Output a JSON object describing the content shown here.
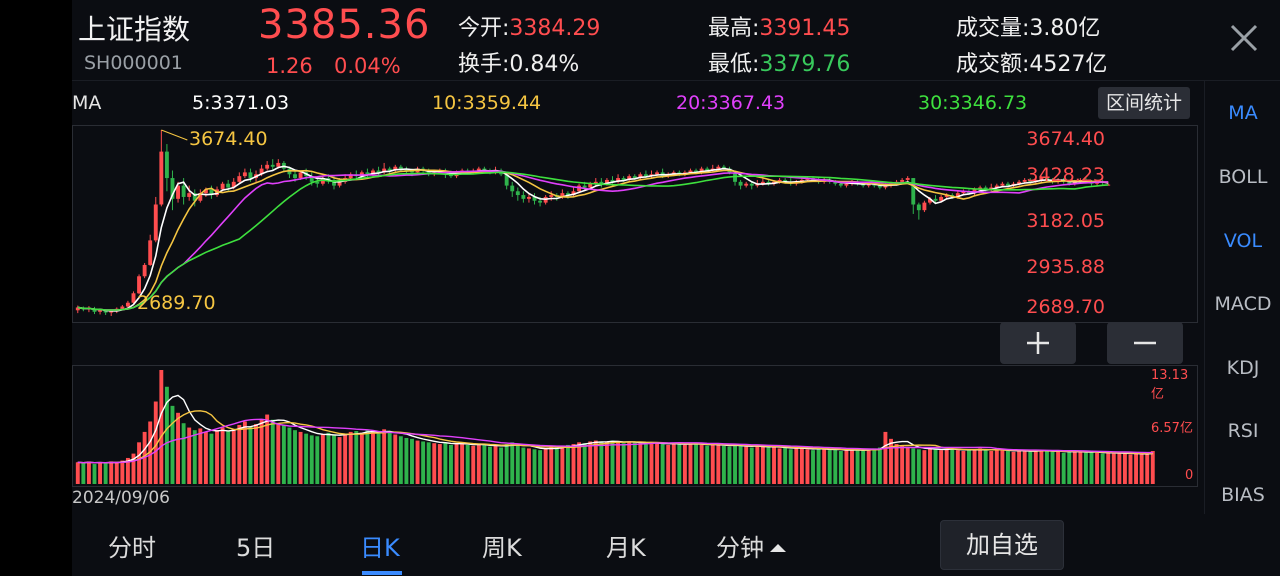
{
  "stock": {
    "name": "上证指数",
    "code": "SH000001",
    "price": "3385.36",
    "change": "1.26",
    "change_pct": "0.04%"
  },
  "stats": [
    {
      "label": "今开:",
      "value": "3384.29",
      "color": "r"
    },
    {
      "label": "最高:",
      "value": "3391.45",
      "color": "r"
    },
    {
      "label": "成交量:",
      "value": "3.80亿",
      "color": ""
    },
    {
      "label": "换手:",
      "value": "0.84%",
      "color": ""
    },
    {
      "label": "最低:",
      "value": "3379.76",
      "color": "g"
    },
    {
      "label": "成交额:",
      "value": "4527亿",
      "color": ""
    }
  ],
  "ma": {
    "label": "MA",
    "ma5": "5:3371.03",
    "ma10": "10:3359.44",
    "ma20": "20:3367.43",
    "ma30": "30:3346.73",
    "colors": {
      "ma5": "#ffffff",
      "ma10": "#f5c542",
      "ma20": "#e040fb",
      "ma30": "#3ee03e"
    }
  },
  "range_button": "区间统计",
  "price_axis": [
    "3674.40",
    "3428.23",
    "3182.05",
    "2935.88",
    "2689.70"
  ],
  "annot_high": "3674.40",
  "annot_low": "2689.70",
  "vol_axis": [
    "13.13亿",
    "6.57亿",
    "0"
  ],
  "date": "2024/09/06",
  "sidebar": [
    "MA",
    "BOLL",
    "VOL",
    "MACD",
    "KDJ",
    "RSI",
    "BIAS"
  ],
  "tabs": [
    "分时",
    "5日",
    "日K",
    "周K",
    "月K",
    "分钟"
  ],
  "add_button": "加自选",
  "colors": {
    "up": "#ff4d4f",
    "down": "#2fb34c",
    "accent": "#3a8bff"
  },
  "chart_data": {
    "type": "candlestick",
    "ylim": [
      2689.7,
      3674.4
    ],
    "candles": [
      [
        2720,
        2735,
        2705,
        2745
      ],
      [
        2735,
        2725,
        2715,
        2740
      ],
      [
        2725,
        2730,
        2710,
        2742
      ],
      [
        2730,
        2712,
        2700,
        2738
      ],
      [
        2712,
        2720,
        2698,
        2730
      ],
      [
        2720,
        2708,
        2695,
        2725
      ],
      [
        2708,
        2715,
        2690,
        2722
      ],
      [
        2715,
        2728,
        2705,
        2735
      ],
      [
        2728,
        2740,
        2720,
        2748
      ],
      [
        2740,
        2760,
        2735,
        2770
      ],
      [
        2760,
        2810,
        2755,
        2820
      ],
      [
        2810,
        2900,
        2805,
        2910
      ],
      [
        2900,
        2960,
        2890,
        2970
      ],
      [
        2960,
        3090,
        2955,
        3120
      ],
      [
        3090,
        3280,
        3080,
        3320
      ],
      [
        3280,
        3560,
        3270,
        3674.4
      ],
      [
        3560,
        3420,
        3350,
        3600
      ],
      [
        3420,
        3310,
        3250,
        3460
      ],
      [
        3310,
        3380,
        3290,
        3400
      ],
      [
        3380,
        3320,
        3280,
        3420
      ],
      [
        3320,
        3340,
        3300,
        3380
      ],
      [
        3340,
        3300,
        3270,
        3360
      ],
      [
        3300,
        3340,
        3290,
        3360
      ],
      [
        3340,
        3360,
        3320,
        3370
      ],
      [
        3360,
        3330,
        3310,
        3380
      ],
      [
        3330,
        3360,
        3320,
        3375
      ],
      [
        3360,
        3390,
        3350,
        3400
      ],
      [
        3390,
        3370,
        3350,
        3410
      ],
      [
        3370,
        3400,
        3360,
        3420
      ],
      [
        3400,
        3430,
        3390,
        3450
      ],
      [
        3430,
        3450,
        3420,
        3470
      ],
      [
        3450,
        3420,
        3400,
        3470
      ],
      [
        3420,
        3440,
        3400,
        3460
      ],
      [
        3440,
        3470,
        3430,
        3490
      ],
      [
        3470,
        3490,
        3460,
        3510
      ],
      [
        3490,
        3480,
        3460,
        3520
      ],
      [
        3480,
        3500,
        3470,
        3520
      ],
      [
        3500,
        3470,
        3450,
        3510
      ],
      [
        3470,
        3440,
        3420,
        3480
      ],
      [
        3440,
        3420,
        3400,
        3460
      ],
      [
        3420,
        3450,
        3410,
        3460
      ],
      [
        3450,
        3430,
        3410,
        3470
      ],
      [
        3430,
        3400,
        3380,
        3450
      ],
      [
        3400,
        3390,
        3370,
        3420
      ],
      [
        3390,
        3420,
        3380,
        3430
      ],
      [
        3420,
        3410,
        3390,
        3440
      ],
      [
        3410,
        3380,
        3360,
        3430
      ],
      [
        3380,
        3400,
        3370,
        3420
      ],
      [
        3400,
        3420,
        3390,
        3440
      ],
      [
        3420,
        3440,
        3410,
        3450
      ],
      [
        3440,
        3430,
        3410,
        3460
      ],
      [
        3430,
        3450,
        3420,
        3460
      ],
      [
        3450,
        3440,
        3420,
        3470
      ],
      [
        3440,
        3460,
        3430,
        3470
      ],
      [
        3460,
        3450,
        3430,
        3480
      ],
      [
        3450,
        3470,
        3440,
        3500
      ],
      [
        3470,
        3460,
        3440,
        3480
      ],
      [
        3460,
        3480,
        3450,
        3490
      ],
      [
        3480,
        3470,
        3460,
        3490
      ],
      [
        3470,
        3460,
        3440,
        3480
      ],
      [
        3460,
        3450,
        3430,
        3470
      ],
      [
        3450,
        3470,
        3440,
        3480
      ],
      [
        3470,
        3460,
        3450,
        3480
      ],
      [
        3460,
        3440,
        3430,
        3470
      ],
      [
        3440,
        3450,
        3430,
        3460
      ],
      [
        3450,
        3460,
        3440,
        3470
      ],
      [
        3460,
        3440,
        3420,
        3470
      ],
      [
        3440,
        3430,
        3420,
        3460
      ],
      [
        3430,
        3450,
        3420,
        3460
      ],
      [
        3450,
        3460,
        3440,
        3470
      ],
      [
        3460,
        3450,
        3440,
        3470
      ],
      [
        3450,
        3460,
        3440,
        3470
      ],
      [
        3460,
        3470,
        3450,
        3480
      ],
      [
        3470,
        3460,
        3450,
        3480
      ],
      [
        3460,
        3450,
        3440,
        3470
      ],
      [
        3450,
        3460,
        3440,
        3480
      ],
      [
        3460,
        3440,
        3430,
        3470
      ],
      [
        3440,
        3380,
        3360,
        3450
      ],
      [
        3380,
        3350,
        3320,
        3400
      ],
      [
        3350,
        3330,
        3300,
        3370
      ],
      [
        3330,
        3310,
        3290,
        3350
      ],
      [
        3310,
        3320,
        3290,
        3340
      ],
      [
        3320,
        3300,
        3280,
        3340
      ],
      [
        3300,
        3290,
        3270,
        3320
      ],
      [
        3290,
        3320,
        3280,
        3330
      ],
      [
        3320,
        3330,
        3300,
        3350
      ],
      [
        3330,
        3320,
        3300,
        3340
      ],
      [
        3320,
        3340,
        3310,
        3360
      ],
      [
        3340,
        3330,
        3310,
        3350
      ],
      [
        3330,
        3350,
        3320,
        3370
      ],
      [
        3350,
        3380,
        3340,
        3390
      ],
      [
        3380,
        3370,
        3350,
        3400
      ],
      [
        3370,
        3390,
        3360,
        3400
      ],
      [
        3390,
        3400,
        3380,
        3420
      ],
      [
        3400,
        3390,
        3370,
        3420
      ],
      [
        3390,
        3410,
        3380,
        3420
      ],
      [
        3410,
        3400,
        3390,
        3430
      ],
      [
        3400,
        3420,
        3390,
        3440
      ],
      [
        3420,
        3410,
        3400,
        3430
      ],
      [
        3410,
        3430,
        3400,
        3440
      ],
      [
        3430,
        3420,
        3410,
        3440
      ],
      [
        3420,
        3440,
        3410,
        3450
      ],
      [
        3440,
        3430,
        3420,
        3460
      ],
      [
        3430,
        3440,
        3420,
        3460
      ],
      [
        3440,
        3450,
        3430,
        3460
      ],
      [
        3450,
        3430,
        3420,
        3470
      ],
      [
        3430,
        3440,
        3420,
        3450
      ],
      [
        3440,
        3450,
        3430,
        3460
      ],
      [
        3450,
        3440,
        3430,
        3460
      ],
      [
        3440,
        3450,
        3430,
        3460
      ],
      [
        3450,
        3460,
        3440,
        3470
      ],
      [
        3460,
        3450,
        3440,
        3470
      ],
      [
        3450,
        3470,
        3440,
        3480
      ],
      [
        3470,
        3460,
        3450,
        3480
      ],
      [
        3460,
        3470,
        3450,
        3490
      ],
      [
        3470,
        3480,
        3460,
        3490
      ],
      [
        3480,
        3470,
        3460,
        3490
      ],
      [
        3470,
        3450,
        3440,
        3480
      ],
      [
        3450,
        3400,
        3380,
        3460
      ],
      [
        3400,
        3380,
        3360,
        3410
      ],
      [
        3380,
        3390,
        3370,
        3400
      ],
      [
        3390,
        3380,
        3360,
        3400
      ],
      [
        3380,
        3390,
        3370,
        3410
      ],
      [
        3390,
        3400,
        3380,
        3420
      ],
      [
        3400,
        3390,
        3380,
        3410
      ],
      [
        3390,
        3400,
        3380,
        3410
      ],
      [
        3400,
        3410,
        3390,
        3420
      ],
      [
        3410,
        3400,
        3390,
        3420
      ],
      [
        3400,
        3390,
        3380,
        3420
      ],
      [
        3390,
        3400,
        3380,
        3410
      ],
      [
        3400,
        3410,
        3390,
        3420
      ],
      [
        3410,
        3420,
        3400,
        3430
      ],
      [
        3420,
        3410,
        3400,
        3430
      ],
      [
        3410,
        3400,
        3390,
        3420
      ],
      [
        3400,
        3410,
        3390,
        3420
      ],
      [
        3410,
        3400,
        3390,
        3420
      ],
      [
        3400,
        3390,
        3380,
        3410
      ],
      [
        3390,
        3380,
        3370,
        3400
      ],
      [
        3380,
        3390,
        3370,
        3400
      ],
      [
        3390,
        3400,
        3380,
        3410
      ],
      [
        3400,
        3390,
        3380,
        3410
      ],
      [
        3390,
        3380,
        3370,
        3400
      ],
      [
        3380,
        3390,
        3370,
        3400
      ],
      [
        3390,
        3380,
        3370,
        3400
      ],
      [
        3380,
        3370,
        3360,
        3390
      ],
      [
        3370,
        3380,
        3360,
        3390
      ],
      [
        3380,
        3390,
        3370,
        3400
      ],
      [
        3390,
        3400,
        3380,
        3410
      ],
      [
        3400,
        3410,
        3390,
        3420
      ],
      [
        3410,
        3420,
        3400,
        3430
      ],
      [
        3420,
        3280,
        3230,
        3420
      ],
      [
        3280,
        3250,
        3200,
        3290
      ],
      [
        3250,
        3290,
        3240,
        3300
      ],
      [
        3290,
        3310,
        3280,
        3320
      ],
      [
        3310,
        3300,
        3290,
        3330
      ],
      [
        3300,
        3320,
        3290,
        3330
      ],
      [
        3320,
        3330,
        3310,
        3340
      ],
      [
        3330,
        3320,
        3310,
        3340
      ],
      [
        3320,
        3340,
        3310,
        3350
      ],
      [
        3340,
        3350,
        3330,
        3360
      ],
      [
        3350,
        3340,
        3330,
        3360
      ],
      [
        3340,
        3360,
        3330,
        3370
      ],
      [
        3360,
        3370,
        3350,
        3380
      ],
      [
        3370,
        3360,
        3350,
        3380
      ],
      [
        3360,
        3370,
        3350,
        3390
      ],
      [
        3370,
        3380,
        3360,
        3390
      ],
      [
        3380,
        3390,
        3370,
        3400
      ],
      [
        3390,
        3380,
        3370,
        3400
      ],
      [
        3380,
        3390,
        3370,
        3400
      ],
      [
        3390,
        3400,
        3380,
        3410
      ],
      [
        3400,
        3410,
        3390,
        3420
      ],
      [
        3410,
        3400,
        3390,
        3420
      ],
      [
        3400,
        3410,
        3390,
        3420
      ],
      [
        3410,
        3420,
        3400,
        3430
      ],
      [
        3420,
        3410,
        3400,
        3430
      ],
      [
        3410,
        3400,
        3390,
        3420
      ],
      [
        3400,
        3410,
        3390,
        3420
      ],
      [
        3410,
        3400,
        3390,
        3420
      ],
      [
        3400,
        3390,
        3380,
        3410
      ],
      [
        3390,
        3400,
        3380,
        3410
      ],
      [
        3400,
        3410,
        3390,
        3420
      ],
      [
        3410,
        3400,
        3390,
        3420
      ],
      [
        3400,
        3390,
        3380,
        3410
      ],
      [
        3390,
        3400,
        3380,
        3410
      ],
      [
        3400,
        3395,
        3380,
        3410
      ],
      [
        3384.29,
        3385.36,
        3379.76,
        3391.45
      ]
    ],
    "volumes": [
      2.5,
      2.4,
      2.6,
      2.3,
      2.5,
      2.4,
      2.6,
      2.5,
      2.7,
      3.0,
      3.5,
      4.8,
      6.0,
      7.2,
      9.5,
      13.13,
      11.2,
      9.0,
      8.2,
      7.0,
      6.5,
      6.2,
      6.4,
      6.0,
      5.8,
      6.2,
      6.5,
      6.1,
      6.3,
      6.8,
      7.2,
      6.6,
      6.9,
      7.5,
      8.0,
      7.4,
      7.0,
      6.8,
      6.5,
      6.2,
      6.0,
      5.8,
      5.6,
      5.5,
      5.7,
      5.9,
      5.6,
      5.4,
      5.8,
      6.0,
      6.1,
      5.9,
      6.2,
      6.0,
      5.8,
      6.3,
      6.0,
      5.7,
      5.5,
      5.3,
      5.2,
      5.0,
      4.9,
      4.8,
      4.7,
      4.6,
      4.8,
      4.5,
      4.6,
      4.7,
      4.5,
      4.4,
      4.6,
      4.5,
      4.3,
      4.4,
      4.2,
      4.6,
      4.8,
      4.4,
      4.2,
      4.1,
      4.0,
      3.9,
      4.1,
      4.3,
      4.2,
      4.4,
      4.5,
      4.6,
      4.8,
      4.7,
      4.9,
      5.0,
      4.8,
      4.9,
      5.0,
      4.8,
      4.7,
      4.9,
      4.8,
      4.7,
      4.6,
      4.8,
      4.7,
      4.6,
      4.5,
      4.7,
      4.6,
      4.5,
      4.7,
      4.6,
      4.5,
      4.4,
      4.6,
      4.5,
      4.4,
      4.3,
      4.5,
      4.4,
      4.3,
      4.2,
      4.4,
      4.3,
      4.2,
      4.3,
      4.1,
      4.2,
      4.0,
      4.1,
      4.2,
      4.0,
      3.9,
      4.1,
      4.0,
      3.9,
      4.0,
      3.8,
      3.9,
      4.0,
      3.9,
      3.8,
      4.0,
      4.1,
      4.2,
      6.0,
      5.2,
      4.6,
      4.4,
      4.2,
      4.1,
      4.0,
      3.9,
      4.1,
      4.0,
      3.9,
      4.0,
      4.1,
      3.9,
      3.8,
      3.9,
      4.0,
      4.1,
      3.9,
      3.8,
      3.9,
      4.0,
      3.8,
      3.7,
      3.8,
      3.9,
      3.7,
      3.8,
      3.9,
      3.8,
      3.7,
      3.8,
      3.6,
      3.7,
      3.8,
      3.7,
      3.6,
      3.7,
      3.6,
      3.5,
      3.6,
      3.5,
      3.6,
      3.5,
      3.4,
      3.5,
      3.4,
      3.5,
      3.8
    ]
  }
}
